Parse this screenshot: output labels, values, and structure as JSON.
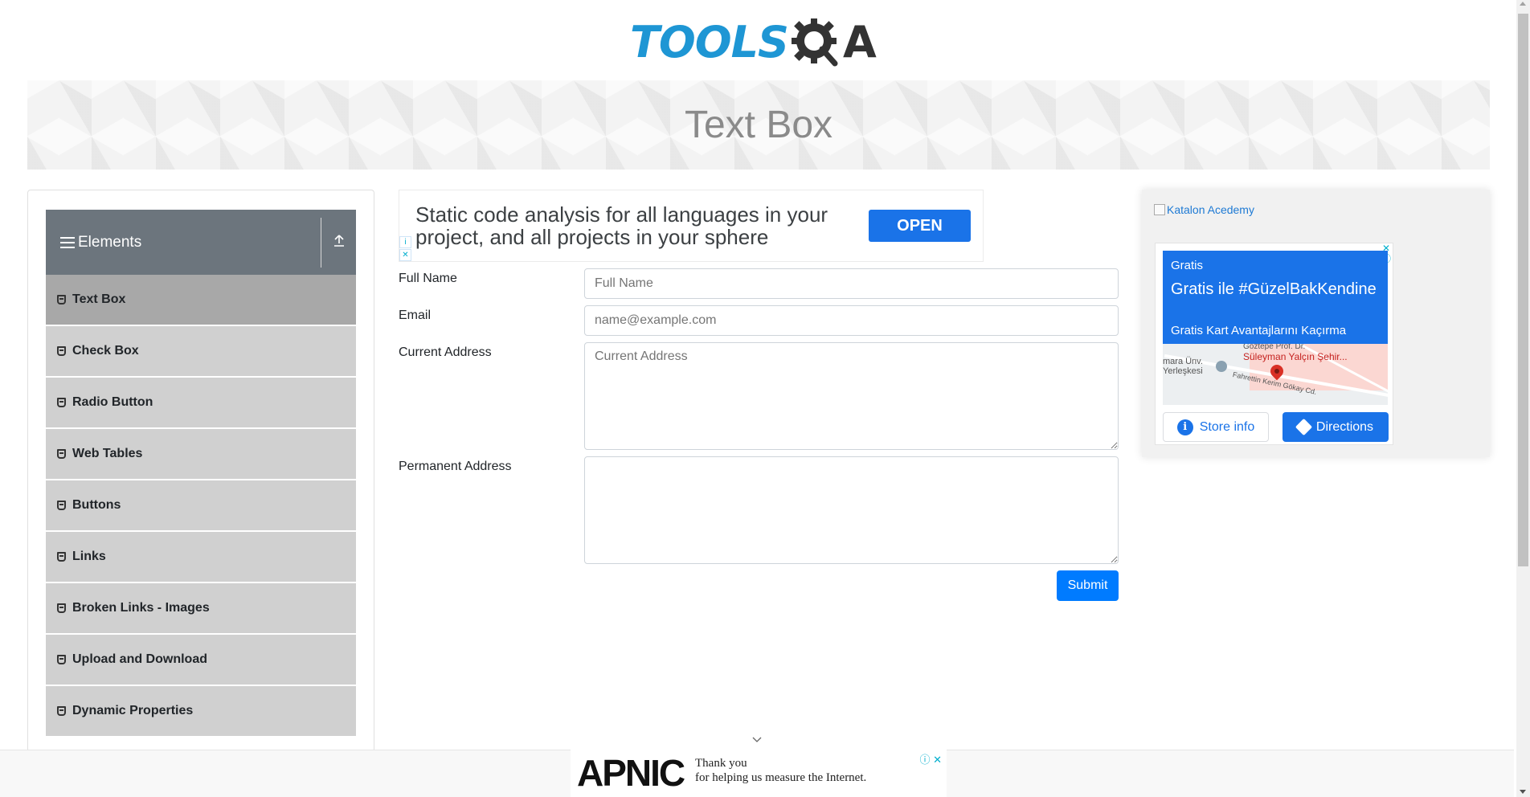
{
  "logo": {
    "part1": "TOOLS",
    "part2": "A"
  },
  "banner": {
    "title": "Text Box"
  },
  "sidebar": {
    "group_title": "Elements",
    "items": [
      {
        "label": "Text Box",
        "active": true
      },
      {
        "label": "Check Box"
      },
      {
        "label": "Radio Button"
      },
      {
        "label": "Web Tables"
      },
      {
        "label": "Buttons"
      },
      {
        "label": "Links"
      },
      {
        "label": "Broken Links - Images"
      },
      {
        "label": "Upload and Download"
      },
      {
        "label": "Dynamic Properties"
      }
    ]
  },
  "top_ad": {
    "text": "Static code analysis for all languages in your project, and all projects in your sphere",
    "button": "OPEN"
  },
  "form": {
    "full_name_label": "Full Name",
    "full_name_placeholder": "Full Name",
    "email_label": "Email",
    "email_placeholder": "name@example.com",
    "current_address_label": "Current Address",
    "current_address_placeholder": "Current Address",
    "permanent_address_label": "Permanent Address",
    "submit_label": "Submit"
  },
  "right_ad": {
    "image_alt": "Katalon Acedemy",
    "gratis_small": "Gratis",
    "gratis_big": "Gratis ile #GüzelBakKendine",
    "gratis_sub": "Gratis Kart Avantajlarını Kaçırma",
    "map_labels": {
      "place": "Süleyman Yalçın Şehir...",
      "campus": "mara Ünv. Yerleşkesi",
      "street": "Fahrettin Kerim Gökay Cd.",
      "top_partial": "Göztepe Prof. Dr."
    },
    "store_info": "Store info",
    "directions": "Directions"
  },
  "bottom_ad": {
    "brand": "APNIC",
    "message_line1": "Thank you",
    "message_line2": "for helping us measure the Internet."
  },
  "colors": {
    "primary": "#007bff",
    "logo_blue": "#1e96d4",
    "sidebar_header": "#6c757d",
    "menu_item": "#d0d0d0",
    "menu_active": "#a8a8a8",
    "ad_blue": "#1a73e8"
  }
}
